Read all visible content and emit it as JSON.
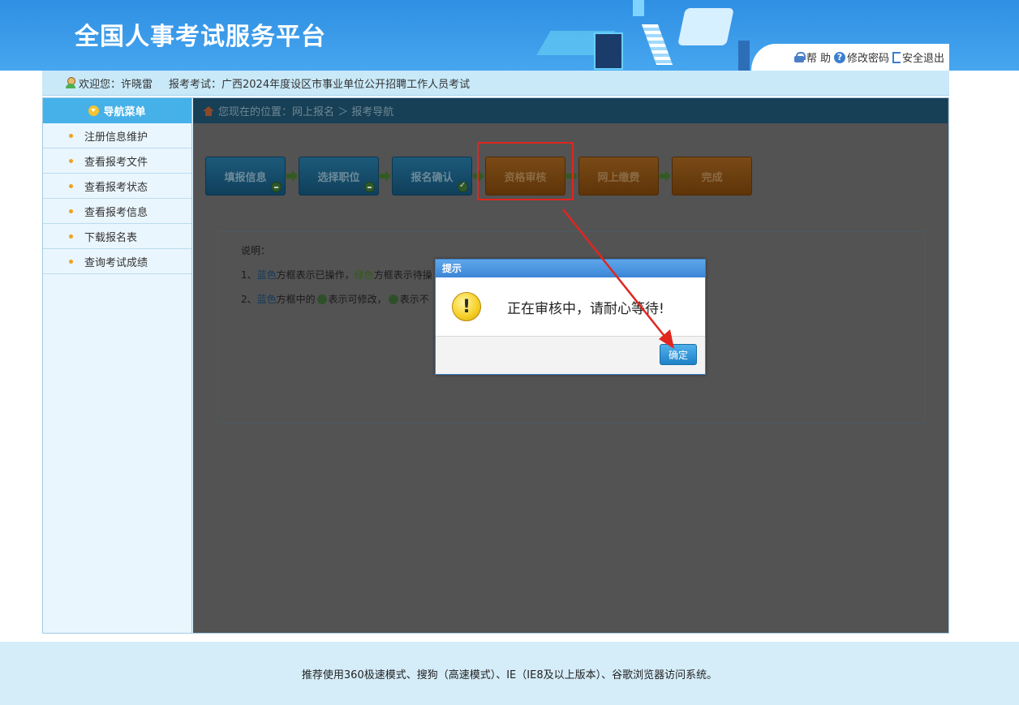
{
  "header": {
    "title": "全国人事考试服务平台",
    "help_label": "帮 助",
    "change_password_label": "修改密码",
    "logout_label": "安全退出"
  },
  "infobar": {
    "welcome_label": "欢迎您：许晓雷",
    "exam_label": "报考考试：广西2024年度设区市事业单位公开招聘工作人员考试"
  },
  "sidebar": {
    "title": "导航菜单",
    "items": [
      {
        "label": "注册信息维护"
      },
      {
        "label": "查看报考文件"
      },
      {
        "label": "查看报考状态"
      },
      {
        "label": "查看报考信息"
      },
      {
        "label": "下载报名表"
      },
      {
        "label": "查询考试成绩"
      }
    ]
  },
  "breadcrumb": {
    "text": "您现在的位置：网上报名 ＞ 报考导航"
  },
  "steps": [
    {
      "label": "填报信息",
      "color": "blue",
      "badge": "minus"
    },
    {
      "label": "选择职位",
      "color": "blue",
      "badge": "minus"
    },
    {
      "label": "报名确认",
      "color": "blue",
      "badge": "check"
    },
    {
      "label": "资格审核",
      "color": "orange",
      "badge": ""
    },
    {
      "label": "网上缴费",
      "color": "orange",
      "badge": ""
    },
    {
      "label": "完成",
      "color": "orange",
      "badge": ""
    }
  ],
  "description": {
    "heading": "说明：",
    "line1_prefix": "1、",
    "line1_blue": "蓝色",
    "line1_mid": "方框表示已操作，",
    "line1_green": "绿色",
    "line1_suffix": "方框表示待操",
    "line2_prefix": "2、",
    "line2_blue": "蓝色",
    "line2_mid": "方框中的",
    "line2_can_modify": "表示可修改，",
    "line2_cannot": "表示不"
  },
  "dialog": {
    "title": "提示",
    "message": "正在审核中，请耐心等待!",
    "ok_label": "确定"
  },
  "footer": {
    "text": "推荐使用360极速模式、搜狗（高速模式）、IE（IE8及以上版本）、谷歌浏览器访问系统。"
  },
  "colors": {
    "header_blue": "#3b99e8",
    "nav_head": "#45b1e8",
    "overlay": "#535353",
    "highlight_red": "#e0261f",
    "ok_button": "#2a8fd2"
  }
}
